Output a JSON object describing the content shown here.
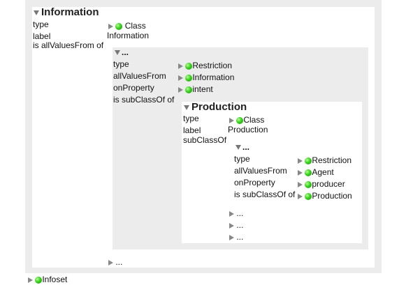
{
  "info": {
    "title": "Information",
    "props": [
      "type",
      "label",
      "is allValuesFrom of"
    ],
    "type_value": "Class",
    "label_value": "Information",
    "more": "..."
  },
  "blank1": {
    "title": "...",
    "props": [
      "type",
      "allValuesFrom",
      "onProperty",
      "is subClassOf of"
    ],
    "values": [
      "Restriction",
      "Information",
      "intent"
    ]
  },
  "production": {
    "title": "Production",
    "props": [
      "type",
      "label",
      "subClassOf"
    ],
    "type_value": "Class",
    "label_value": "Production",
    "more": [
      "...",
      "...",
      "..."
    ]
  },
  "blank2": {
    "title": "...",
    "props": [
      "type",
      "allValuesFrom",
      "onProperty",
      "is subClassOf of"
    ],
    "values": [
      "Restriction",
      "Agent",
      "producer",
      "Production"
    ]
  },
  "infoset": {
    "label": "Infoset"
  }
}
